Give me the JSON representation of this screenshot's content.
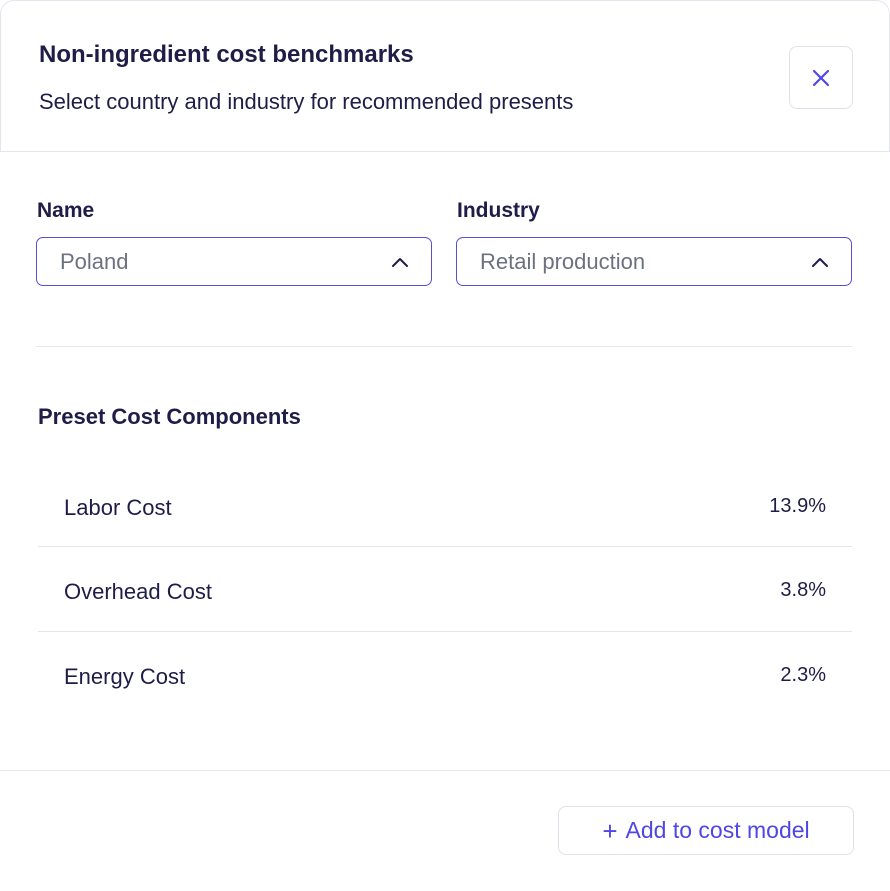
{
  "dialog": {
    "title": "Non-ingredient cost benchmarks",
    "subtitle": "Select country and industry for recommended presents",
    "close_icon": "close-icon"
  },
  "filters": {
    "name": {
      "label": "Name",
      "value": "Poland",
      "icon": "chevron-up-icon"
    },
    "industry": {
      "label": "Industry",
      "value": "Retail production",
      "icon": "chevron-up-icon"
    }
  },
  "preset": {
    "title": "Preset Cost Components",
    "items": [
      {
        "name": "Labor Cost",
        "value": "13.9%"
      },
      {
        "name": "Overhead Cost",
        "value": "3.8%"
      },
      {
        "name": "Energy Cost",
        "value": "2.3%"
      }
    ]
  },
  "footer": {
    "add_label": "Add to cost model",
    "add_icon": "plus-icon"
  },
  "colors": {
    "accent": "#4f46e5",
    "select_border": "#5a4fcf",
    "text": "#1f1d47",
    "muted": "#6b7180"
  }
}
